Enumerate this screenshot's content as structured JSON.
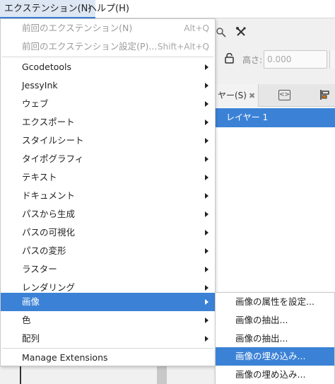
{
  "menubar": {
    "items": [
      {
        "label": "エクステンション(N)",
        "active": true
      },
      {
        "label": "ヘルプ(H)",
        "active": false
      }
    ]
  },
  "background": {
    "height_label": "高さ:",
    "height_value": "0.000",
    "layers_tab_label": "ヤー(S)",
    "layers_tab_close": "✖",
    "layer_row_label": "レイヤー 1"
  },
  "menu": {
    "items": [
      {
        "label": "前回のエクステンション(N)",
        "shortcut": "Alt+Q",
        "disabled": true,
        "submenu": false
      },
      {
        "label": "前回のエクステンション設定(P)...",
        "shortcut": "Shift+Alt+Q",
        "disabled": true,
        "submenu": false
      },
      {
        "label": "Gcodetools",
        "shortcut": "",
        "disabled": false,
        "submenu": true
      },
      {
        "label": "JessyInk",
        "shortcut": "",
        "disabled": false,
        "submenu": true
      },
      {
        "label": "ウェブ",
        "shortcut": "",
        "disabled": false,
        "submenu": true
      },
      {
        "label": "エクスポート",
        "shortcut": "",
        "disabled": false,
        "submenu": true
      },
      {
        "label": "スタイルシート",
        "shortcut": "",
        "disabled": false,
        "submenu": true
      },
      {
        "label": "タイポグラフィ",
        "shortcut": "",
        "disabled": false,
        "submenu": true
      },
      {
        "label": "テキスト",
        "shortcut": "",
        "disabled": false,
        "submenu": true
      },
      {
        "label": "ドキュメント",
        "shortcut": "",
        "disabled": false,
        "submenu": true
      },
      {
        "label": "パスから生成",
        "shortcut": "",
        "disabled": false,
        "submenu": true
      },
      {
        "label": "パスの可視化",
        "shortcut": "",
        "disabled": false,
        "submenu": true
      },
      {
        "label": "パスの変形",
        "shortcut": "",
        "disabled": false,
        "submenu": true
      },
      {
        "label": "ラスター",
        "shortcut": "",
        "disabled": false,
        "submenu": true
      },
      {
        "label": "レンダリング",
        "shortcut": "",
        "disabled": false,
        "submenu": true
      },
      {
        "label": "画像",
        "shortcut": "",
        "disabled": false,
        "submenu": true,
        "highlighted": true
      },
      {
        "label": "色",
        "shortcut": "",
        "disabled": false,
        "submenu": true
      },
      {
        "label": "配列",
        "shortcut": "",
        "disabled": false,
        "submenu": true
      },
      {
        "label": "Manage Extensions",
        "shortcut": "",
        "disabled": false,
        "submenu": false
      }
    ]
  },
  "submenu": {
    "items": [
      {
        "label": "画像の属性を設定...",
        "highlighted": false
      },
      {
        "label": "画像の抽出...",
        "highlighted": false
      },
      {
        "label": "画像の抽出...",
        "highlighted": false
      },
      {
        "label": "画像の埋め込み...",
        "highlighted": true
      },
      {
        "label": "画像の埋め込み...",
        "highlighted": false
      }
    ]
  },
  "colors": {
    "accent": "#3b82d6",
    "disabled_text": "#9a9a9a"
  }
}
